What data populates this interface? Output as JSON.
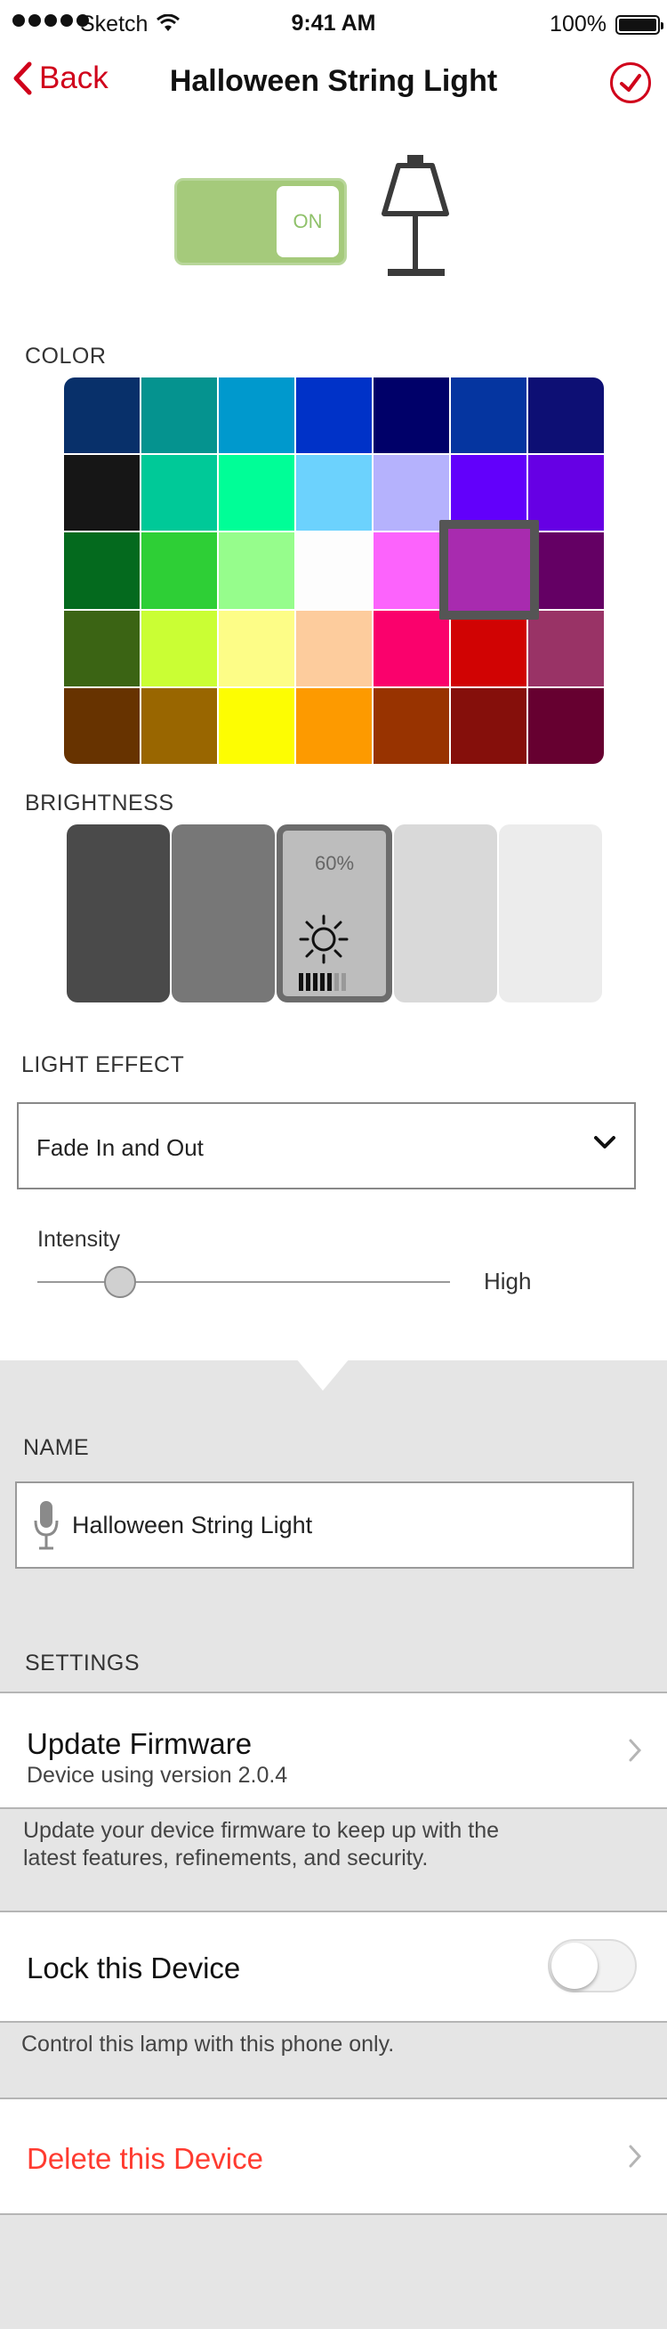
{
  "status_bar": {
    "carrier": "Sketch",
    "time": "9:41 AM",
    "battery": "100%"
  },
  "nav": {
    "back_label": "Back",
    "title": "Halloween String Light"
  },
  "power": {
    "state": "ON"
  },
  "color": {
    "label": "COLOR",
    "swatches": [
      "#08306a",
      "#05938f",
      "#0099cd",
      "#0032c8",
      "#000069",
      "#0535a0",
      "#0d0f74",
      "#161616",
      "#00c998",
      "#00fe97",
      "#6cd2fd",
      "#b5b2fd",
      "#6200fb",
      "#6600e4",
      "#046a1e",
      "#2ecf36",
      "#96fd8c",
      "#fdfdfd",
      "#fc63fc",
      "#a82baf",
      "#640064",
      "#3b6414",
      "#cafe34",
      "#fdfd87",
      "#fdcc9d",
      "#fa016c",
      "#d10303",
      "#993366",
      "#673300",
      "#996600",
      "#fdfd02",
      "#fd9a00",
      "#983300",
      "#850f0b",
      "#660030"
    ],
    "selected_color": "#a82baf"
  },
  "brightness": {
    "label": "BRIGHTNESS",
    "levels": [
      "#4a4a4a",
      "#777777",
      "#bdbdbd",
      "#d9d9d9",
      "#ececec"
    ],
    "selected_value": "60%"
  },
  "light_effect": {
    "label": "LIGHT EFFECT",
    "value": "Fade In and Out"
  },
  "intensity": {
    "label": "Intensity",
    "high_label": "High",
    "level": 0.2
  },
  "name": {
    "label": "NAME",
    "value": "Halloween String Light"
  },
  "settings": {
    "label": "SETTINGS",
    "firmware_title": "Update Firmware",
    "firmware_sub": "Device using version 2.0.4",
    "firmware_note_1": "Update your device firmware to keep up with the",
    "firmware_note_2": "latest features, refinements, and security.",
    "lock_title": "Lock this Device",
    "lock_note": "Control this lamp with this phone only.",
    "delete_title": "Delete this Device"
  },
  "colors": {
    "accent": "#d0021b",
    "delete_text": "#ff3b30",
    "toggle_on": "#a5ca7b"
  }
}
